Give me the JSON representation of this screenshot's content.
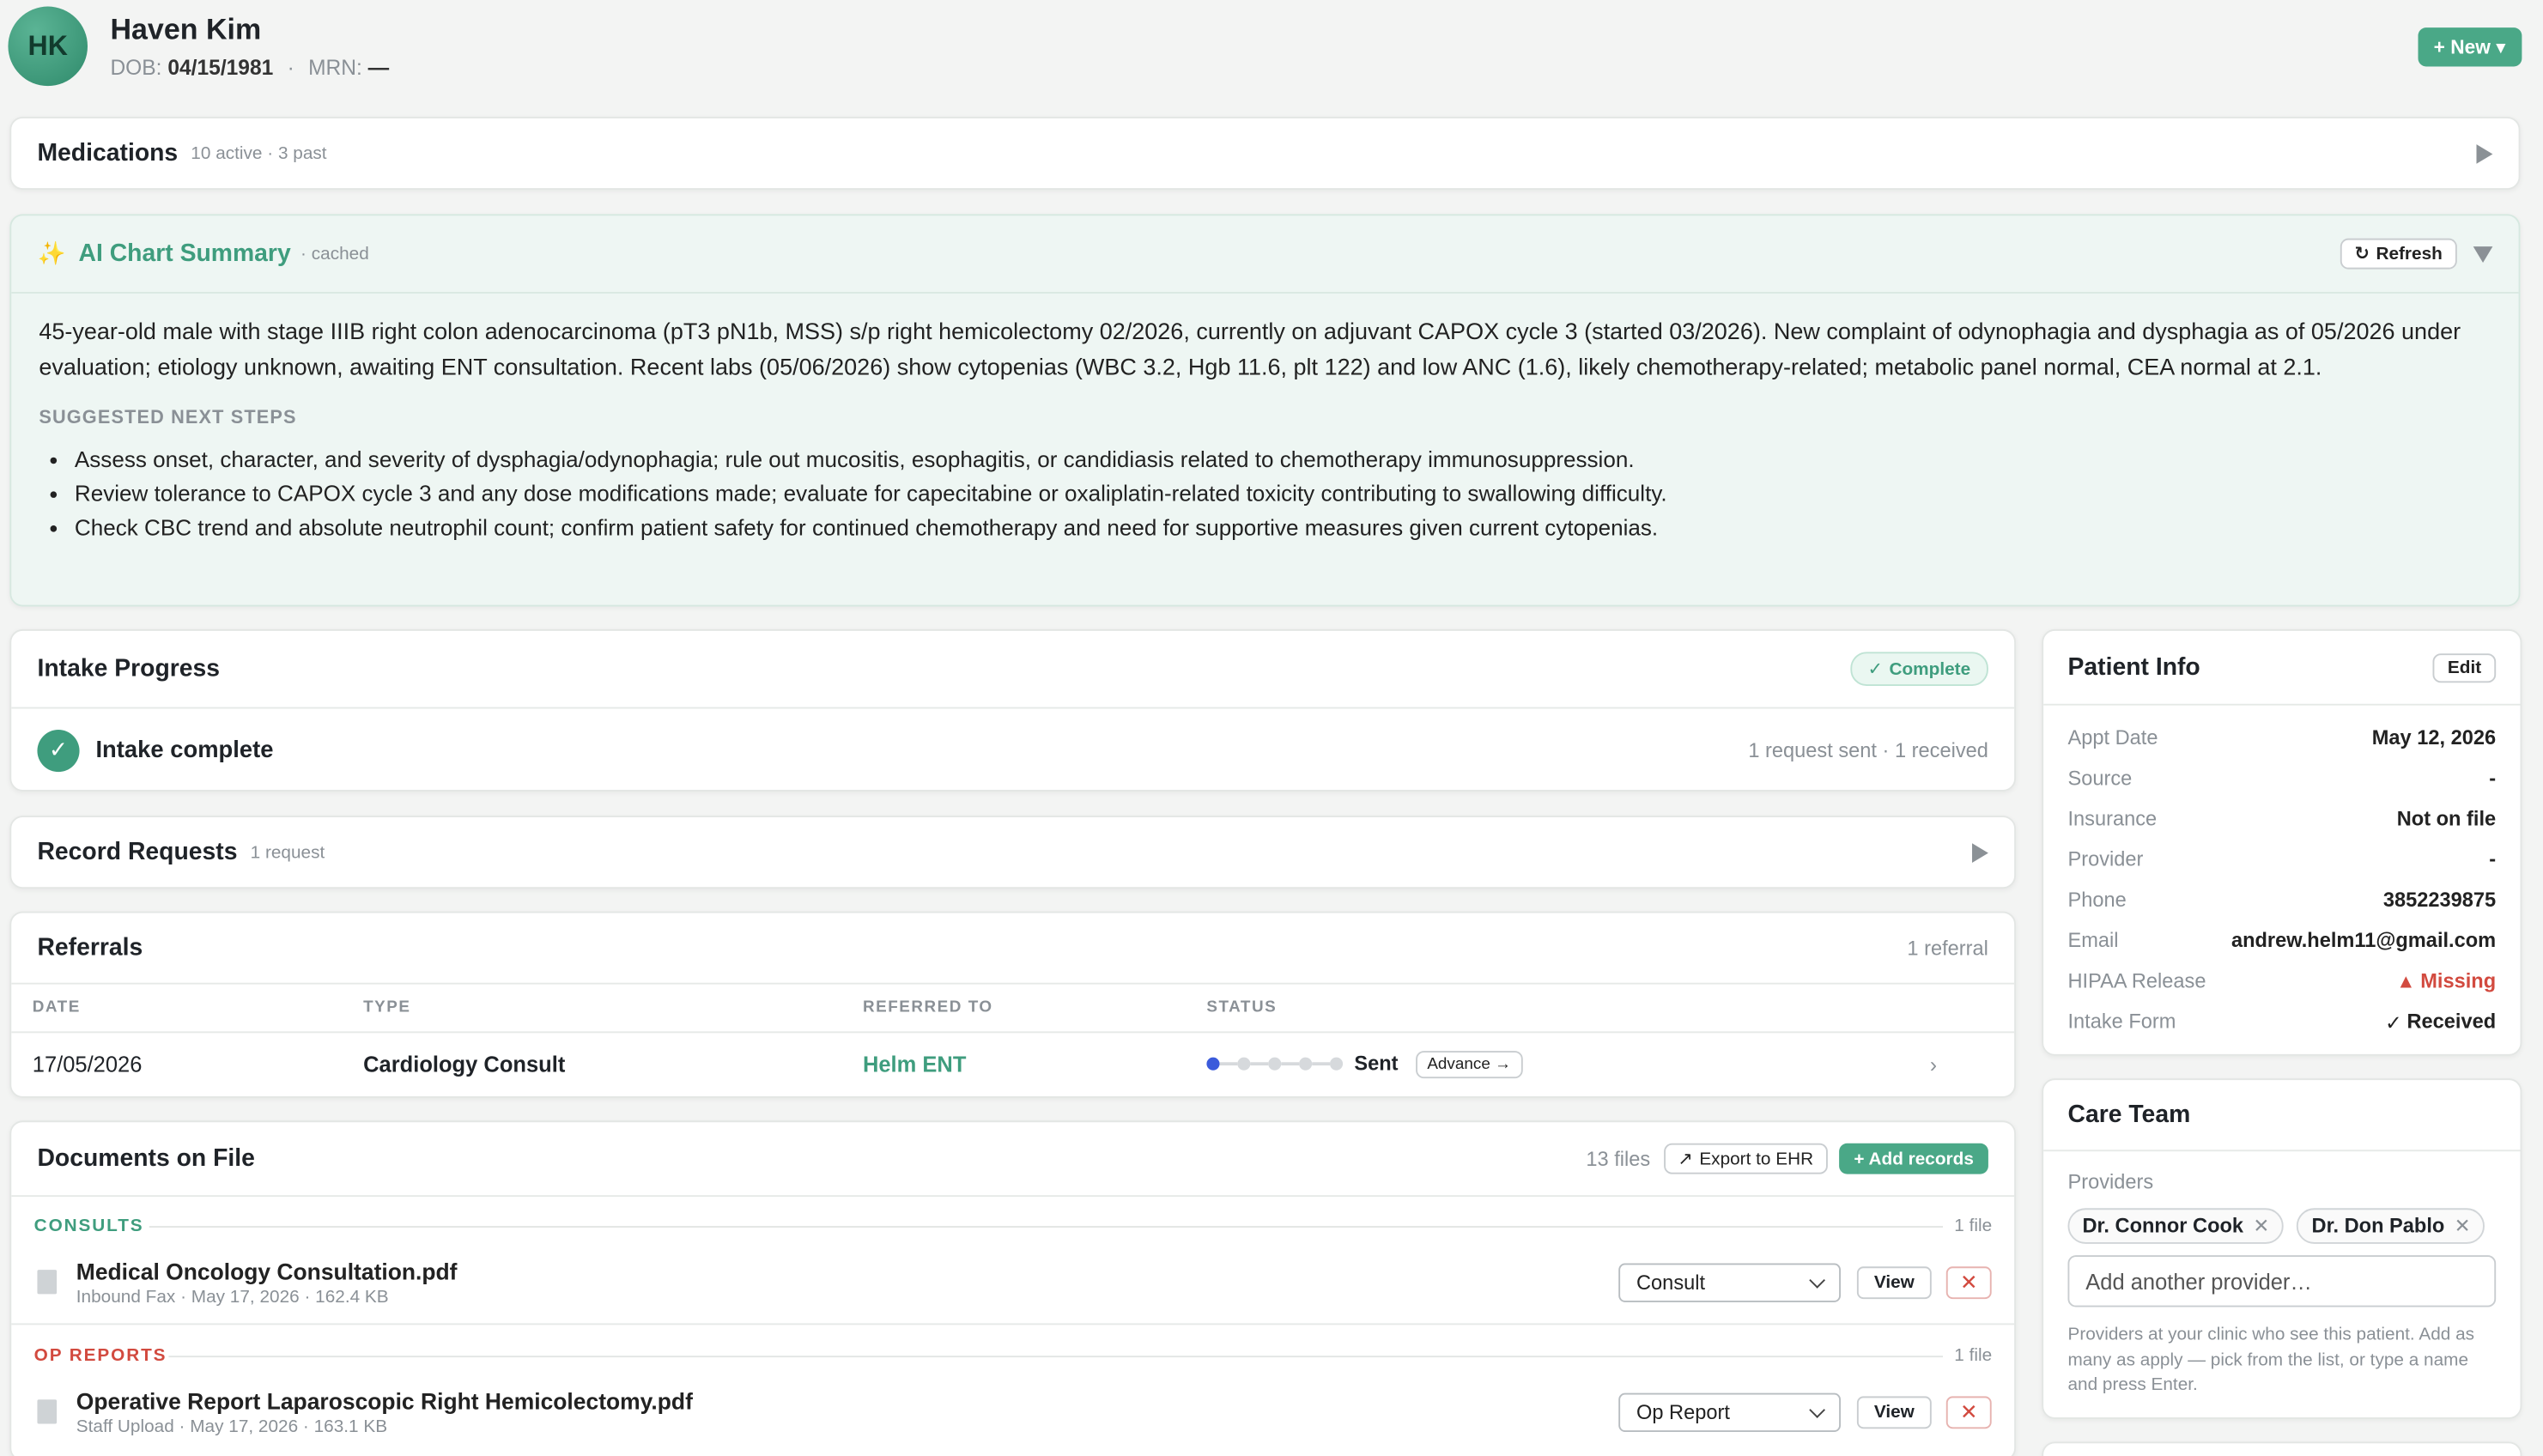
{
  "header": {
    "avatar_initials": "HK",
    "name": "Haven Kim",
    "dob_label": "DOB:",
    "dob": "04/15/1981",
    "separator": "·",
    "mrn_label": "MRN:",
    "mrn": "—",
    "new_button": "+ New ▾"
  },
  "medications": {
    "title": "Medications",
    "subtitle": "10 active · 3 past"
  },
  "ai_summary": {
    "icon": "✨",
    "title": "AI Chart Summary",
    "status": "· cached",
    "refresh_label": "Refresh",
    "summary": "45-year-old male with stage IIIB right colon adenocarcinoma (pT3 pN1b, MSS) s/p right hemicolectomy 02/2026, currently on adjuvant CAPOX cycle 3 (started 03/2026). New complaint of odynophagia and dysphagia as of 05/2026 under evaluation; etiology unknown, awaiting ENT consultation. Recent labs (05/06/2026) show cytopenias (WBC 3.2, Hgb 11.6, plt 122) and low ANC (1.6), likely chemotherapy-related; metabolic panel normal, CEA normal at 2.1.",
    "steps_heading": "SUGGESTED NEXT STEPS",
    "steps": [
      "Assess onset, character, and severity of dysphagia/odynophagia; rule out mucositis, esophagitis, or candidiasis related to chemotherapy immunosuppression.",
      "Review tolerance to CAPOX cycle 3 and any dose modifications made; evaluate for capecitabine or oxaliplatin-related toxicity contributing to swallowing difficulty.",
      "Check CBC trend and absolute neutrophil count; confirm patient safety for continued chemotherapy and need for supportive measures given current cytopenias."
    ]
  },
  "intake": {
    "title": "Intake Progress",
    "badge": "Complete",
    "status": "Intake complete",
    "counts": "1 request sent · 1 received"
  },
  "records": {
    "title": "Record Requests",
    "subtitle": "1 request"
  },
  "referrals": {
    "title": "Referrals",
    "count": "1 referral",
    "columns": [
      "DATE",
      "TYPE",
      "REFERRED TO",
      "STATUS"
    ],
    "rows": [
      {
        "date": "17/05/2026",
        "type": "Cardiology Consult",
        "referred_to": "Helm ENT",
        "status": "Sent",
        "advance": "Advance →",
        "step_index": 0,
        "step_total": 5
      }
    ]
  },
  "documents": {
    "title": "Documents on File",
    "count": "13 files",
    "export_label": "Export to EHR",
    "add_label": "+ Add records",
    "sections": [
      {
        "label": "CONSULTS",
        "count": "1 file",
        "color": "#3f9d7e",
        "files": [
          {
            "name": "Medical Oncology Consultation.pdf",
            "meta": "Inbound Fax · May 17, 2026 · 162.4 KB",
            "category": "Consult"
          }
        ]
      },
      {
        "label": "OP REPORTS",
        "count": "1 file",
        "color": "#d24a3f",
        "files": [
          {
            "name": "Operative Report Laparoscopic Right Hemicolectomy.pdf",
            "meta": "Staff Upload · May 17, 2026 · 163.1 KB",
            "category": "Op Report"
          }
        ]
      }
    ],
    "view_label": "View",
    "remove_glyph": "✕"
  },
  "patient_info": {
    "title": "Patient Info",
    "edit_label": "Edit",
    "rows": [
      {
        "label": "Appt Date",
        "value": "May 12, 2026"
      },
      {
        "label": "Source",
        "value": "-"
      },
      {
        "label": "Insurance",
        "value": "Not on file"
      },
      {
        "label": "Provider",
        "value": "-"
      },
      {
        "label": "Phone",
        "value": "3852239875"
      },
      {
        "label": "Email",
        "value": "andrew.helm11@gmail.com"
      },
      {
        "label": "HIPAA Release",
        "value": "Missing"
      },
      {
        "label": "Intake Form",
        "value": "Received"
      }
    ]
  },
  "care_team": {
    "title": "Care Team",
    "providers_label": "Providers",
    "providers": [
      "Dr. Connor Cook",
      "Dr. Don Pablo"
    ],
    "input_placeholder": "Add another provider…",
    "help": "Providers at your clinic who see this patient. Add as many as apply — pick from the list, or type a name and press Enter."
  },
  "colors": {
    "accent": "#3f9d7e",
    "danger": "#d24a3f",
    "step_active": "#3b5bdb"
  }
}
